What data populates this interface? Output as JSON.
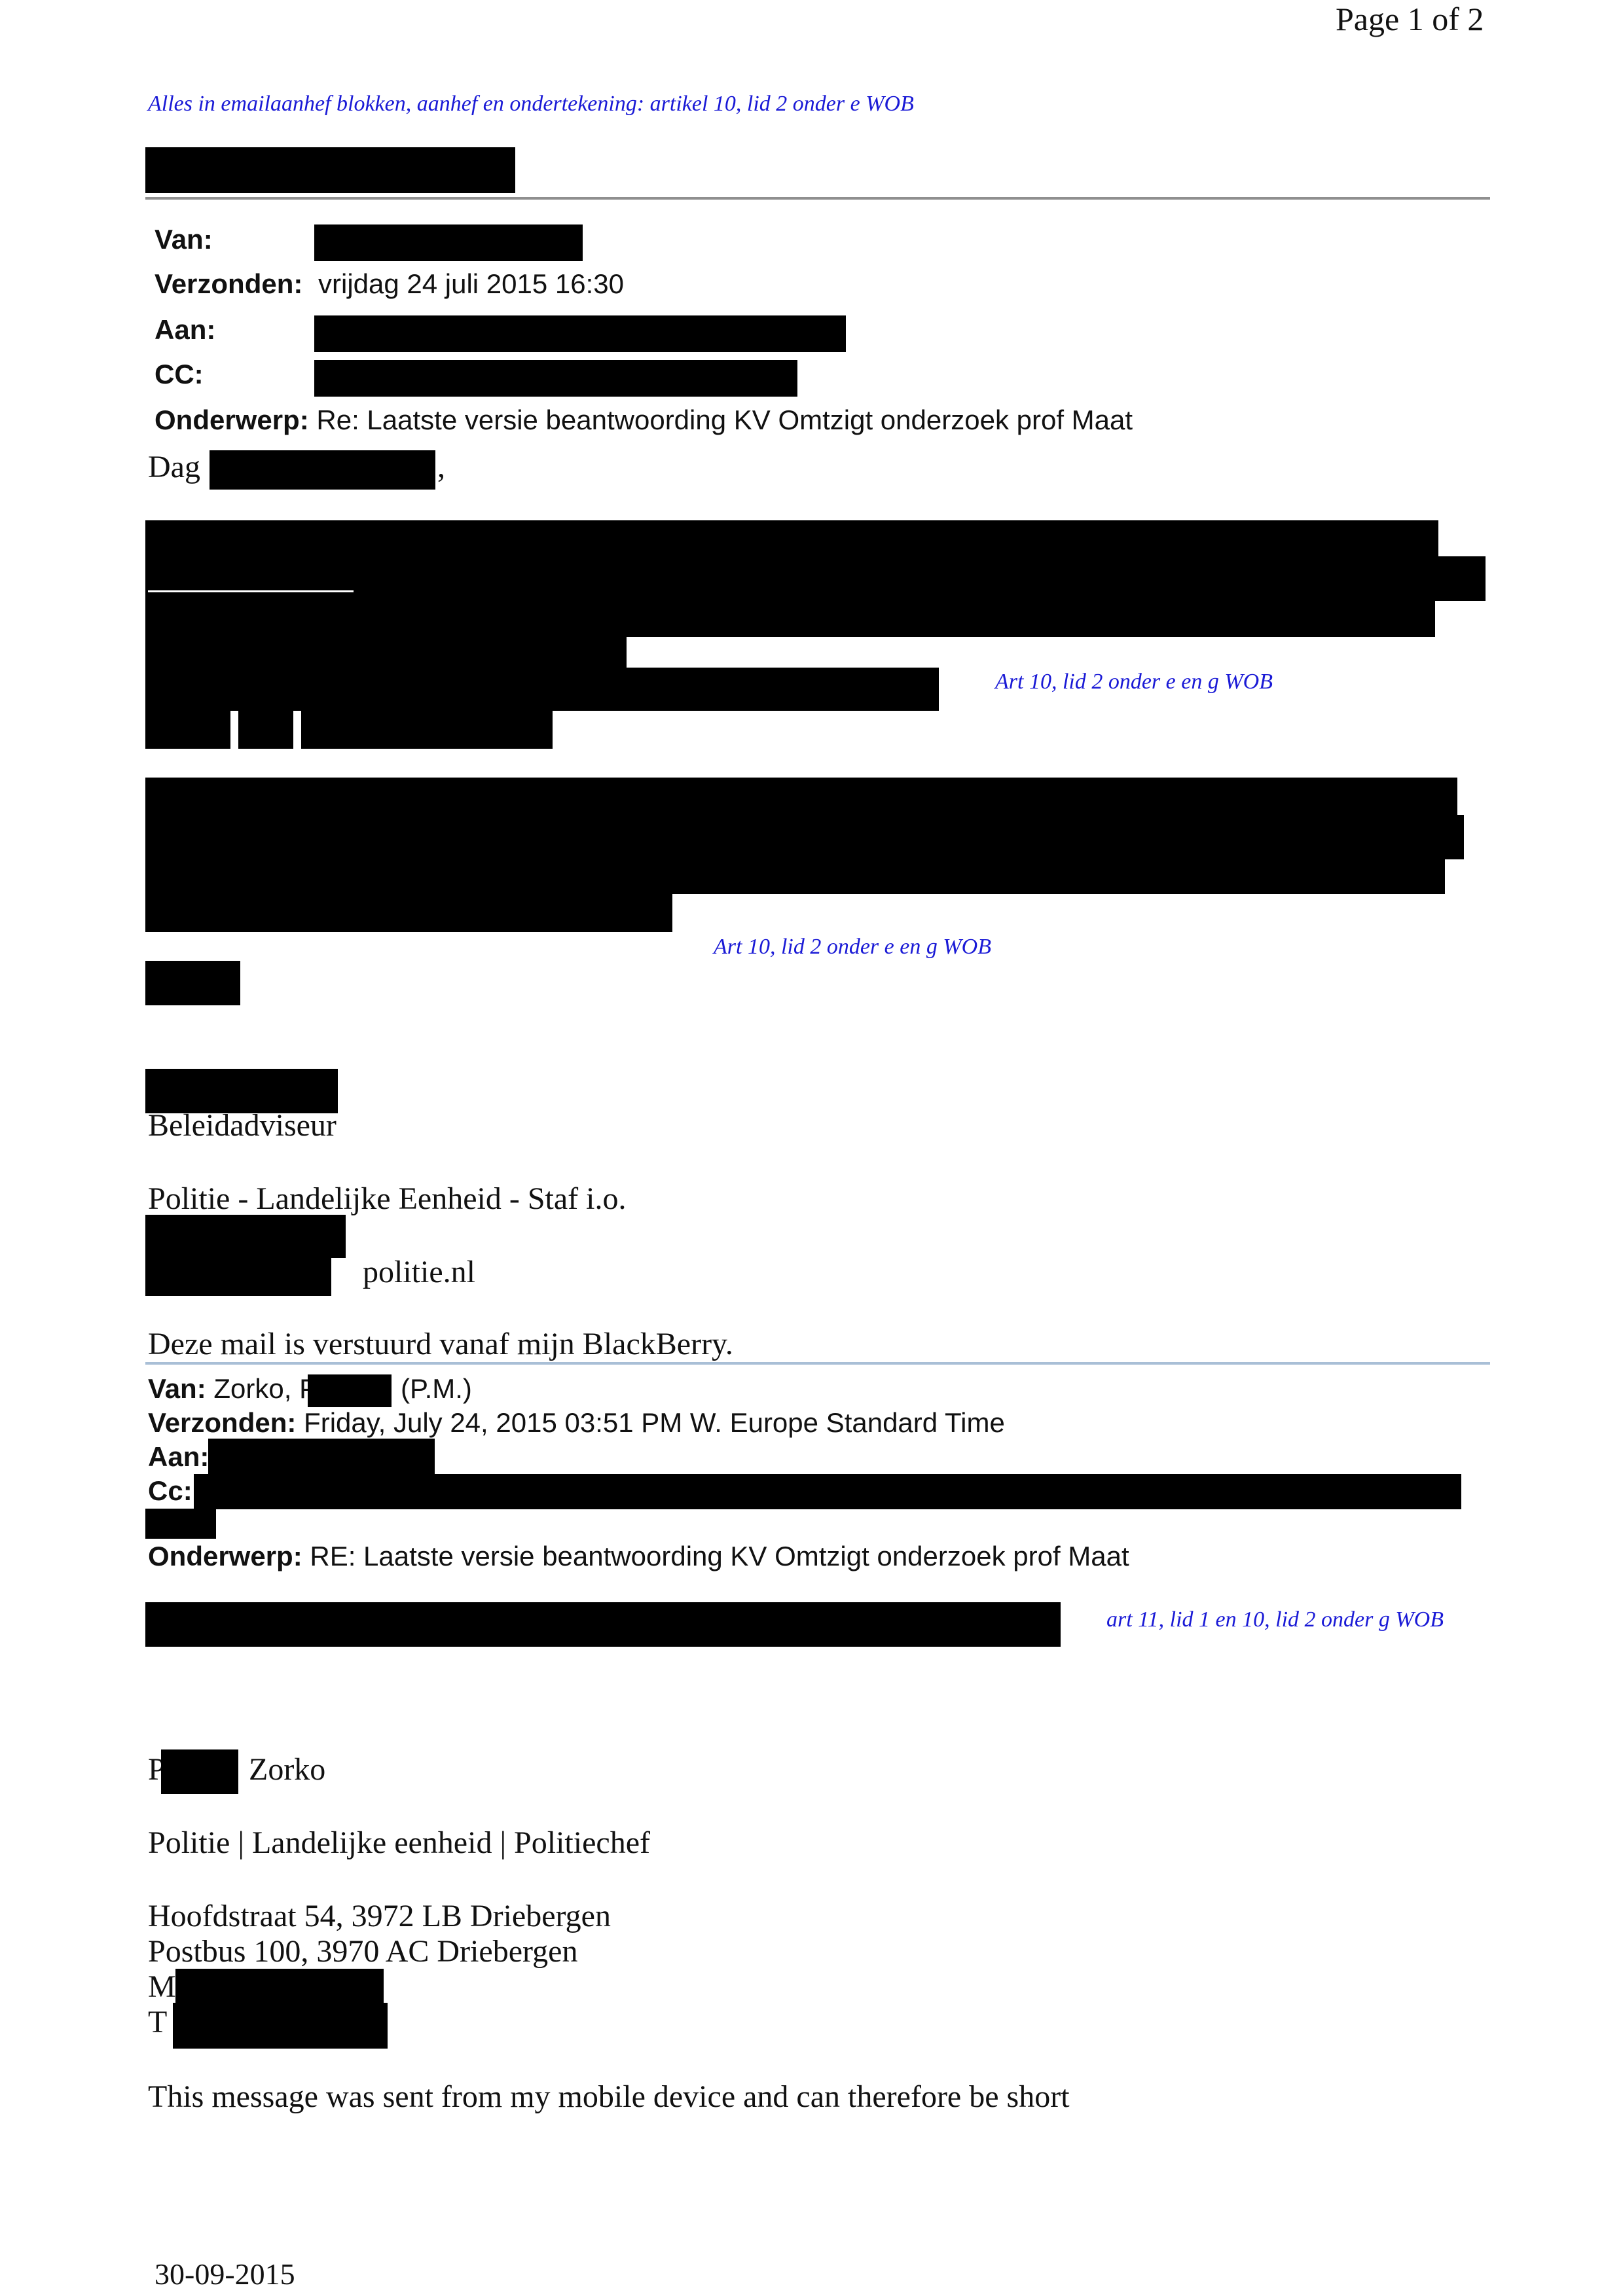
{
  "page_header": "Page 1 of 2",
  "redaction_note_top": "Alles in emailaanhef blokken, aanhef  en ondertekening: artikel 10, lid 2 onder e WOB",
  "email1": {
    "van_label": "Van:",
    "verzonden_label": "Verzonden:",
    "verzonden_value": "vrijdag 24 juli 2015 16:30",
    "aan_label": "Aan:",
    "cc_label": "CC:",
    "onderwerp_label": "Onderwerp:",
    "onderwerp_value": "Re: Laatste versie beantwoording KV Omtzigt onderzoek prof Maat",
    "greeting_start": "Dag",
    "greeting_end": ",",
    "note_1": "Art 10, lid 2 onder e en g WOB",
    "note_2": "Art 10, lid 2 onder e en g WOB",
    "signature_title": "Beleidadviseur",
    "signature_org": "Politie - Landelijke Eenheid - Staf i.o.",
    "signature_domain": "politie.nl",
    "blackberry_note": "Deze mail is verstuurd vanaf mijn BlackBerry."
  },
  "email2": {
    "van_label": "Van:",
    "van_value_start": "Zorko, P",
    "van_value_end": "(P.M.)",
    "verzonden_label": "Verzonden:",
    "verzonden_value": "Friday, July 24, 2015 03:51 PM W. Europe Standard Time",
    "aan_label": "Aan:",
    "cc_label": "Cc:",
    "onderwerp_label": "Onderwerp:",
    "onderwerp_value": "RE: Laatste versie beantwoording KV Omtzigt onderzoek prof Maat",
    "note": "art 11, lid 1 en 10, lid 2 onder g WOB",
    "sig_initial": "P",
    "sig_surname": "Zorko",
    "sig_org": "Politie | Landelijke eenheid | Politiechef",
    "address_1": "Hoofdstraat 54, 3972 LB Driebergen",
    "address_2": "Postbus 100, 3970 AC Driebergen",
    "mobile_prefix": "M",
    "tel_prefix": "T",
    "mobile_note": "This message was sent from my mobile device and can therefore be short"
  },
  "footer_date": "30-09-2015"
}
